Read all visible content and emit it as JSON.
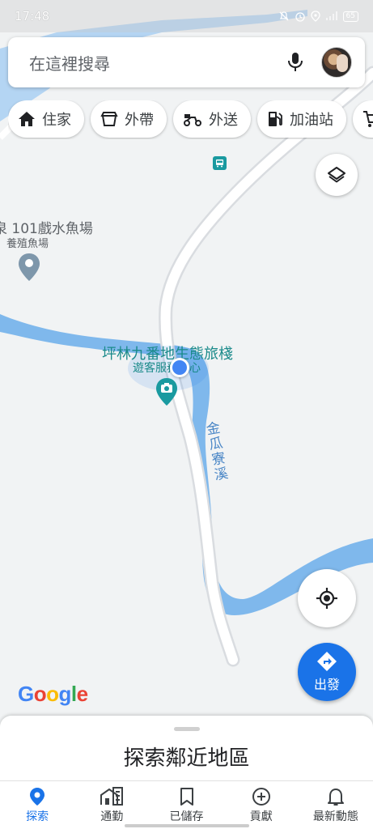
{
  "status_bar": {
    "time": "17:48",
    "battery": "65"
  },
  "search": {
    "placeholder": "在這裡搜尋"
  },
  "chips": [
    {
      "label": "住家",
      "icon": "home-icon"
    },
    {
      "label": "外帶",
      "icon": "takeout-icon"
    },
    {
      "label": "外送",
      "icon": "delivery-scooter-icon"
    },
    {
      "label": "加油站",
      "icon": "gas-station-icon"
    }
  ],
  "map": {
    "poi_fish_farm": "泉 101戲水魚場",
    "poi_fish_farm_category": "養殖魚場",
    "poi_lodge": "坪林九番地生態旅棧",
    "poi_visitor_center": "遊客服務中心",
    "river_label": "金瓜寮溪",
    "colors": {
      "river": "#7fb8ec",
      "road": "#ffffff",
      "land": "#f1f3f4",
      "accent": "#1a73e8",
      "teal": "#1a9aa0"
    }
  },
  "directions": {
    "label": "出發"
  },
  "branding": {
    "logo": "Google"
  },
  "sheet": {
    "title": "探索鄰近地區"
  },
  "nav": [
    {
      "label": "探索",
      "icon": "explore-pin-icon",
      "active": true
    },
    {
      "label": "通勤",
      "icon": "commute-building-icon",
      "active": false
    },
    {
      "label": "已儲存",
      "icon": "bookmark-icon",
      "active": false
    },
    {
      "label": "貢獻",
      "icon": "add-circle-icon",
      "active": false
    },
    {
      "label": "最新動態",
      "icon": "bell-icon",
      "active": false
    }
  ]
}
